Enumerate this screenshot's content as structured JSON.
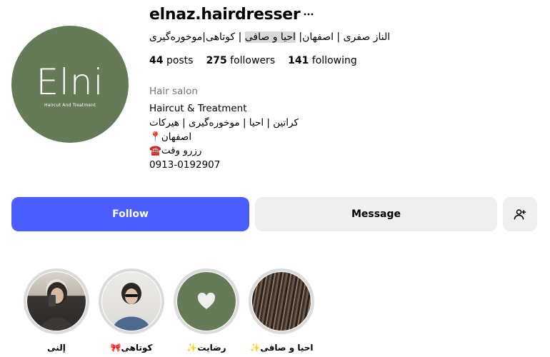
{
  "profile": {
    "username": "elnaz.hairdresser",
    "full_name_part1": "الناز صفری | اصفهان|",
    "full_name_highlight": "احیا و صافی",
    "full_name_part2": "| کوتاهی|موخوره‌گیری",
    "avatar_logo": "Elni",
    "avatar_logo_sub": "Haircut And Treatment",
    "stats": {
      "posts_count": "44",
      "posts_label": "posts",
      "followers_count": "275",
      "followers_label": "followers",
      "following_count": "141",
      "following_label": "following"
    },
    "category": "Hair salon",
    "bio": [
      "Haircut & Treatment",
      "کراتین | احیا | موخوره‌گیری | هیرکات",
      "📍اصفهان",
      "☎️رزرو وقت",
      "0913-0192907"
    ]
  },
  "buttons": {
    "follow": "Follow",
    "message": "Message"
  },
  "highlights": [
    {
      "label": "إلنی"
    },
    {
      "label": "🎀کوتاهی"
    },
    {
      "label": "✨رضایت"
    },
    {
      "label": "✨احیا و صافی"
    }
  ],
  "colors": {
    "accent": "#4a5dff",
    "avatar_bg": "#657a56",
    "button_gray": "#efefef"
  },
  "icons": {
    "more": "more-horizontal-icon",
    "add_user": "person-add-icon",
    "heart": "heart-icon"
  }
}
